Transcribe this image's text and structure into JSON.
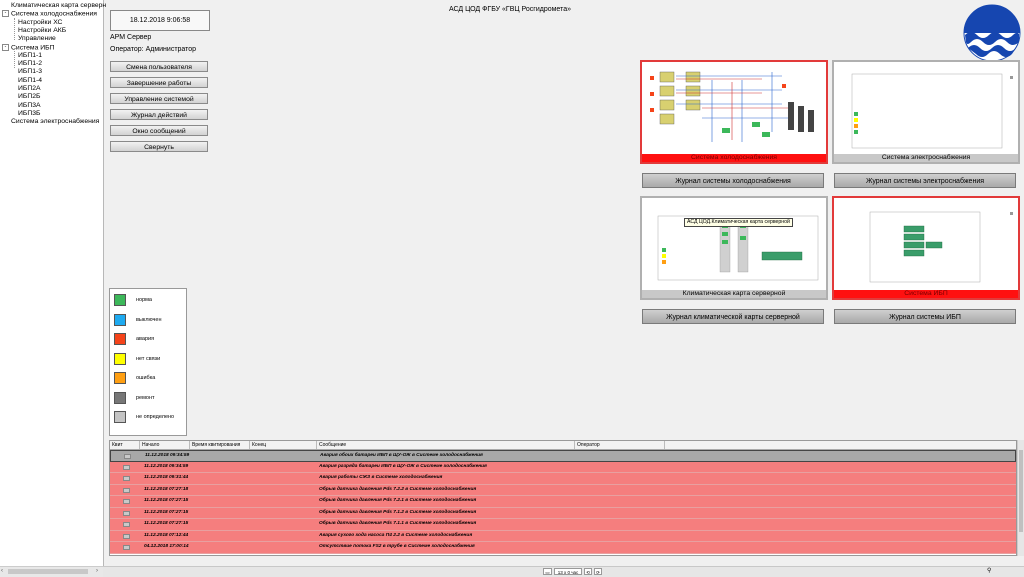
{
  "tree": {
    "items": [
      {
        "label": "Климатическая карта серверн",
        "level": 0
      },
      {
        "label": "Система холодоснабжения",
        "level": 0,
        "expander": "⊟"
      },
      {
        "label": "Настройки ХС",
        "level": 1
      },
      {
        "label": "Настройки АКБ",
        "level": 1
      },
      {
        "label": "Управление",
        "level": 1
      },
      {
        "label": "Система ИБП",
        "level": 0,
        "expander": "⊟"
      },
      {
        "label": "ИБП1-1",
        "level": 1
      },
      {
        "label": "ИБП1-2",
        "level": 1
      },
      {
        "label": "ИБП1-3",
        "level": 1
      },
      {
        "label": "ИБП1-4",
        "level": 1
      },
      {
        "label": "ИБП2А",
        "level": 1
      },
      {
        "label": "ИБП2Б",
        "level": 1
      },
      {
        "label": "ИБП3А",
        "level": 1
      },
      {
        "label": "ИБП3Б",
        "level": 1
      },
      {
        "label": "Система электроснабжения",
        "level": 0
      }
    ]
  },
  "header": {
    "datetime": "18.12.2018 9:06:58",
    "title": "АСД ЦОД ФГБУ «ГВЦ Росгидромета»",
    "workstation": "АРМ Сервер",
    "operator": "Оператор: Администратор"
  },
  "menu": {
    "change_user": "Смена пользователя",
    "shutdown": "Завершение работы",
    "system_control": "Управление системой",
    "action_log": "Журнал действий",
    "messages_window": "Окно сообщений",
    "minimize": "Свернуть"
  },
  "panels": {
    "cooling": {
      "caption": "Система холодоснабжения",
      "journal": "Журнал системы холодоснабжения"
    },
    "power": {
      "caption": "Система электроснабжения",
      "journal": "Журнал системы электроснабжения"
    },
    "climate": {
      "caption": "Климатическая карта серверной",
      "journal": "Журнал климатической карты серверной",
      "tooltip": "АСД ЦОД.Климатическая карта серверной"
    },
    "ups": {
      "caption": "Система ИБП",
      "journal": "Журнал системы ИБП"
    }
  },
  "legend": [
    {
      "label": "норма",
      "color": "#3cb85a"
    },
    {
      "label": "выключен",
      "color": "#1eaaf0"
    },
    {
      "label": "авария",
      "color": "#f5441a"
    },
    {
      "label": "нет связи",
      "color": "#ffff00"
    },
    {
      "label": "ошибка",
      "color": "#ff9f12"
    },
    {
      "label": "ремонт",
      "color": "#777777"
    },
    {
      "label": "не определено",
      "color": "#c4c4c4"
    }
  ],
  "events": {
    "columns": [
      "Квит",
      "Начало",
      "Время квитирования",
      "Конец",
      "Сообщение",
      "Оператор"
    ],
    "rows": [
      {
        "start": "11.12.2018 09:34:59",
        "message": "Авария обоих батареи ИБП в ЩУ-ОЖ в Системе холодоснабжения"
      },
      {
        "start": "11.12.2018 09:34:59",
        "message": "Авария разряда батареи ИБП в ЩУ-ОЖ в Системе холодоснабжения"
      },
      {
        "start": "11.12.2018 09:31:44",
        "message": "Авария работы СЖЗ в Системе холодоснабжения"
      },
      {
        "start": "11.12.2018 07:27:18",
        "message": "Обрыв датчика давления Pds 7.2.2 в Системе холодоснабжения"
      },
      {
        "start": "11.12.2018 07:27:15",
        "message": "Обрыв датчика давления Pds 7.2.1 в Системе холодоснабжения"
      },
      {
        "start": "11.12.2018 07:27:15",
        "message": "Обрыв датчика давления Pds 7.1.2 в Системе холодоснабжения"
      },
      {
        "start": "11.12.2018 07:27:15",
        "message": "Обрыв датчика давления Pds 7.1.1 в Системе холодоснабжения"
      },
      {
        "start": "11.12.2018 07:12:44",
        "message": "Авария сухого хода насоса П4 2.2 в Системе холодоснабжения"
      },
      {
        "start": "04.12.2018 17:00:14",
        "message": "Отсутствие потока FS2 в трубе в Системе холодоснабжения"
      }
    ]
  },
  "statusbar": {
    "interval": "13 x 0 час"
  },
  "colors": {
    "alarm_row": "#f57e7e",
    "alarm_border": "#e23a3a",
    "logo_blue": "#1646b0"
  }
}
